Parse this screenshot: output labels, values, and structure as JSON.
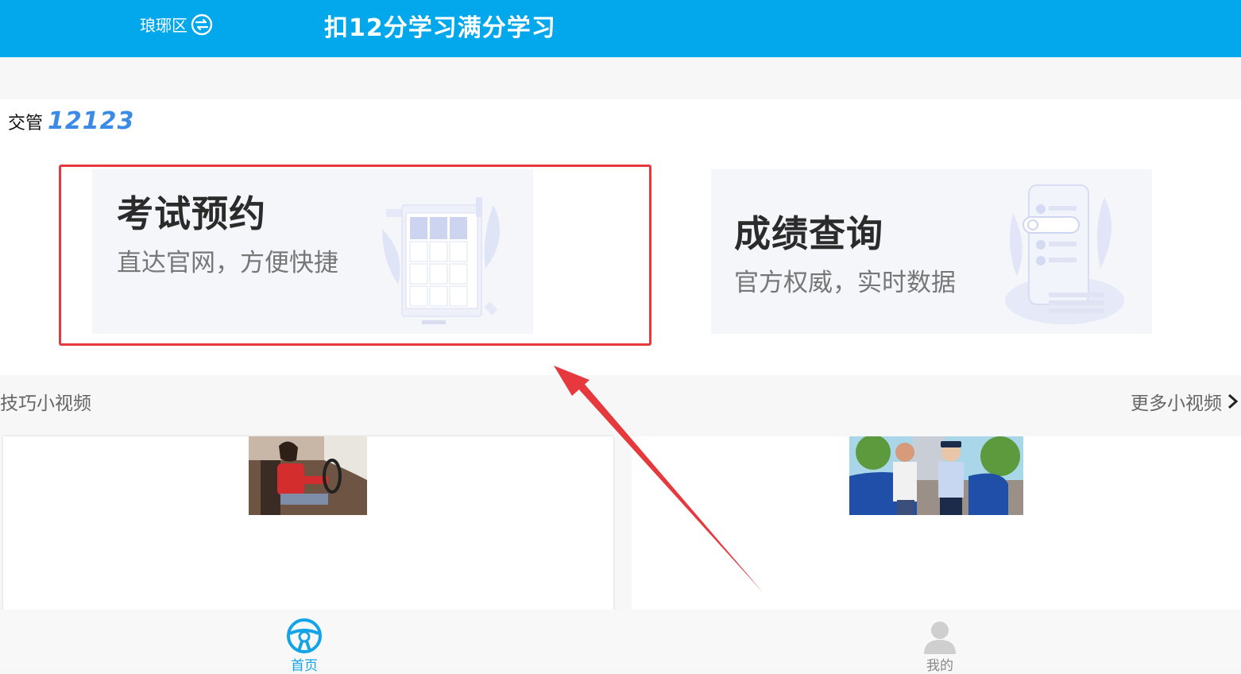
{
  "header": {
    "city": "琅琊区",
    "city_icon": "switch-icon",
    "title": "扣12分学习满分学习",
    "bg_color": "#02a7ec"
  },
  "brand": {
    "text": "交管",
    "number": "12123"
  },
  "cards": [
    {
      "title": "考试预约",
      "subtitle": "直达官网，方便快捷",
      "icon": "calendar-illustration"
    },
    {
      "title": "成绩查询",
      "subtitle": "官方权威，实时数据",
      "icon": "phone-list-illustration"
    }
  ],
  "videos": {
    "section_title": "技巧小视频",
    "more_label": "更多小视频",
    "items": [
      {
        "thumb": "driver-in-car-thumbnail"
      },
      {
        "thumb": "police-checking-driver-thumbnail"
      }
    ]
  },
  "tabbar": {
    "items": [
      {
        "label": "首页",
        "icon": "steering-wheel-icon",
        "active": true
      },
      {
        "label": "我的",
        "icon": "user-icon",
        "active": false
      }
    ]
  },
  "annotation": {
    "highlight_color": "#e5393d"
  }
}
